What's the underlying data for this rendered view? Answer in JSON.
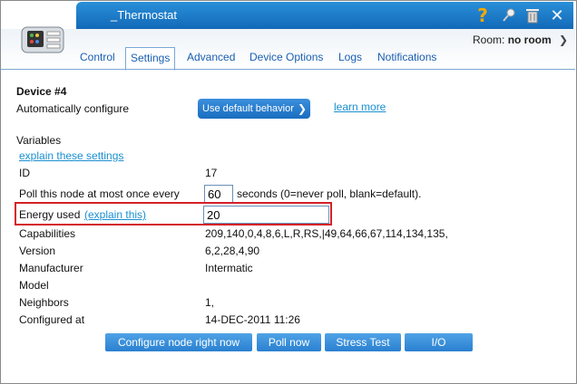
{
  "window": {
    "title": "_Thermostat",
    "icons": [
      "help-icon",
      "pin-icon",
      "trash-icon",
      "close-icon"
    ]
  },
  "header": {
    "room_label": "Room:",
    "room_value": "no room"
  },
  "tabs": [
    {
      "label": "Control",
      "active": false
    },
    {
      "label": "Settings",
      "active": true
    },
    {
      "label": "Advanced",
      "active": false
    },
    {
      "label": "Device Options",
      "active": false
    },
    {
      "label": "Logs",
      "active": false
    },
    {
      "label": "Notifications",
      "active": false
    }
  ],
  "settings": {
    "device_title": "Device #4",
    "auto_config_label": "Automatically configure",
    "auto_config_value": "Use default behavior",
    "learn_more": "learn more",
    "variables_heading": "Variables",
    "explain_settings": "explain these settings",
    "rows": {
      "id": {
        "label": "ID",
        "value": "17"
      },
      "poll": {
        "label": "Poll this node at most once every",
        "value": "60",
        "suffix": "seconds (0=never poll, blank=default)."
      },
      "energy": {
        "label": "Energy used",
        "link": "(explain this)",
        "value": "20"
      },
      "capabilities": {
        "label": "Capabilities",
        "value": "209,140,0,4,8,6,L,R,RS,|49,64,66,67,114,134,135,"
      },
      "version": {
        "label": "Version",
        "value": "6,2,28,4,90"
      },
      "manufacturer": {
        "label": "Manufacturer",
        "value": "Intermatic"
      },
      "model": {
        "label": "Model",
        "value": ""
      },
      "neighbors": {
        "label": "Neighbors",
        "value": "1,"
      },
      "configured": {
        "label": "Configured at",
        "value": "14-DEC-2011 11:26"
      }
    }
  },
  "buttons": {
    "configure": "Configure node right now",
    "poll": "Poll now",
    "stress": "Stress Test",
    "io": "I/O"
  },
  "colors": {
    "titlebar": "#1a77c8",
    "link": "#1a8fd0",
    "highlight": "#d42127",
    "button": "#3a90dc"
  }
}
